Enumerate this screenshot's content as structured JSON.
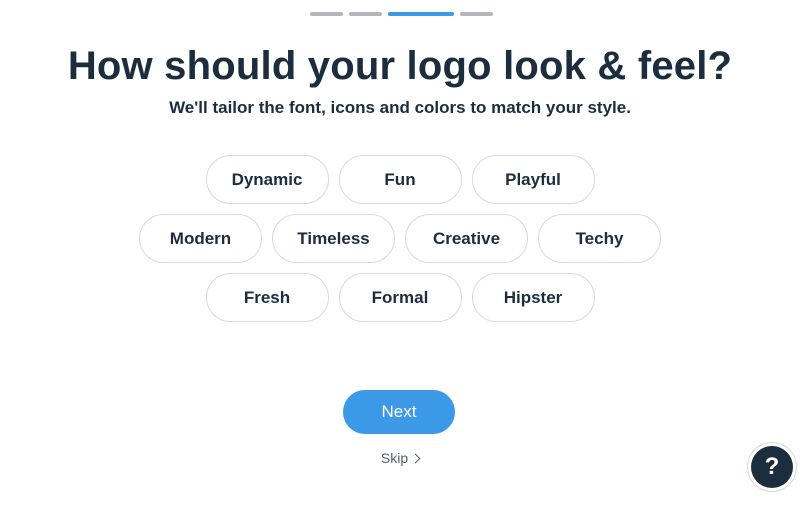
{
  "progress": {
    "total_steps": 4,
    "current_step": 3,
    "active_color": "#3b99e8",
    "inactive_color": "#b3b7bc"
  },
  "header": {
    "title": "How should your logo look & feel?",
    "subtitle": "We'll tailor the font, icons and colors to match your style."
  },
  "styles": {
    "rows": [
      [
        "Dynamic",
        "Fun",
        "Playful"
      ],
      [
        "Modern",
        "Timeless",
        "Creative",
        "Techy"
      ],
      [
        "Fresh",
        "Formal",
        "Hipster"
      ]
    ]
  },
  "actions": {
    "next_label": "Next",
    "skip_label": "Skip",
    "next_color": "#3b99e8"
  },
  "help": {
    "label": "?",
    "icon": "question-mark-icon"
  }
}
